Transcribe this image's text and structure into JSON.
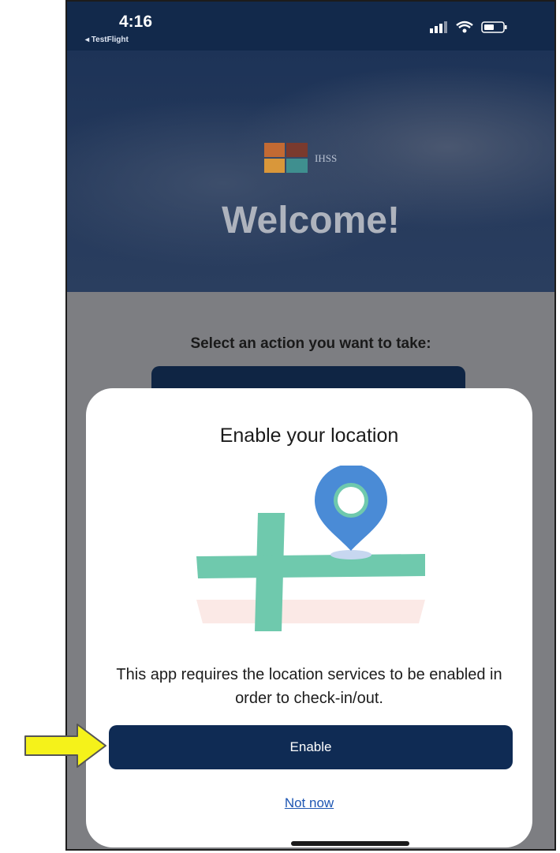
{
  "status_bar": {
    "time": "4:16",
    "back_app": "◂ TestFlight",
    "icons": [
      "signal-icon",
      "wifi-icon",
      "battery-icon"
    ]
  },
  "hero": {
    "logo_text": "IHSS",
    "title": "Welcome!"
  },
  "main": {
    "prompt": "Select an action you want to take:"
  },
  "modal": {
    "title": "Enable your location",
    "illustration": "map-location-pin-icon",
    "body": "This app requires the location services to be enabled in order to check-in/out.",
    "enable_label": "Enable",
    "not_now_label": "Not now"
  },
  "annotation": {
    "icon": "arrow-right-icon"
  },
  "colors": {
    "navy": "#0f2b54",
    "pin_blue": "#4a8bd6",
    "road_green": "#6fc9ad",
    "link_blue": "#1e56b3",
    "arrow_yellow": "#f5f21a"
  }
}
